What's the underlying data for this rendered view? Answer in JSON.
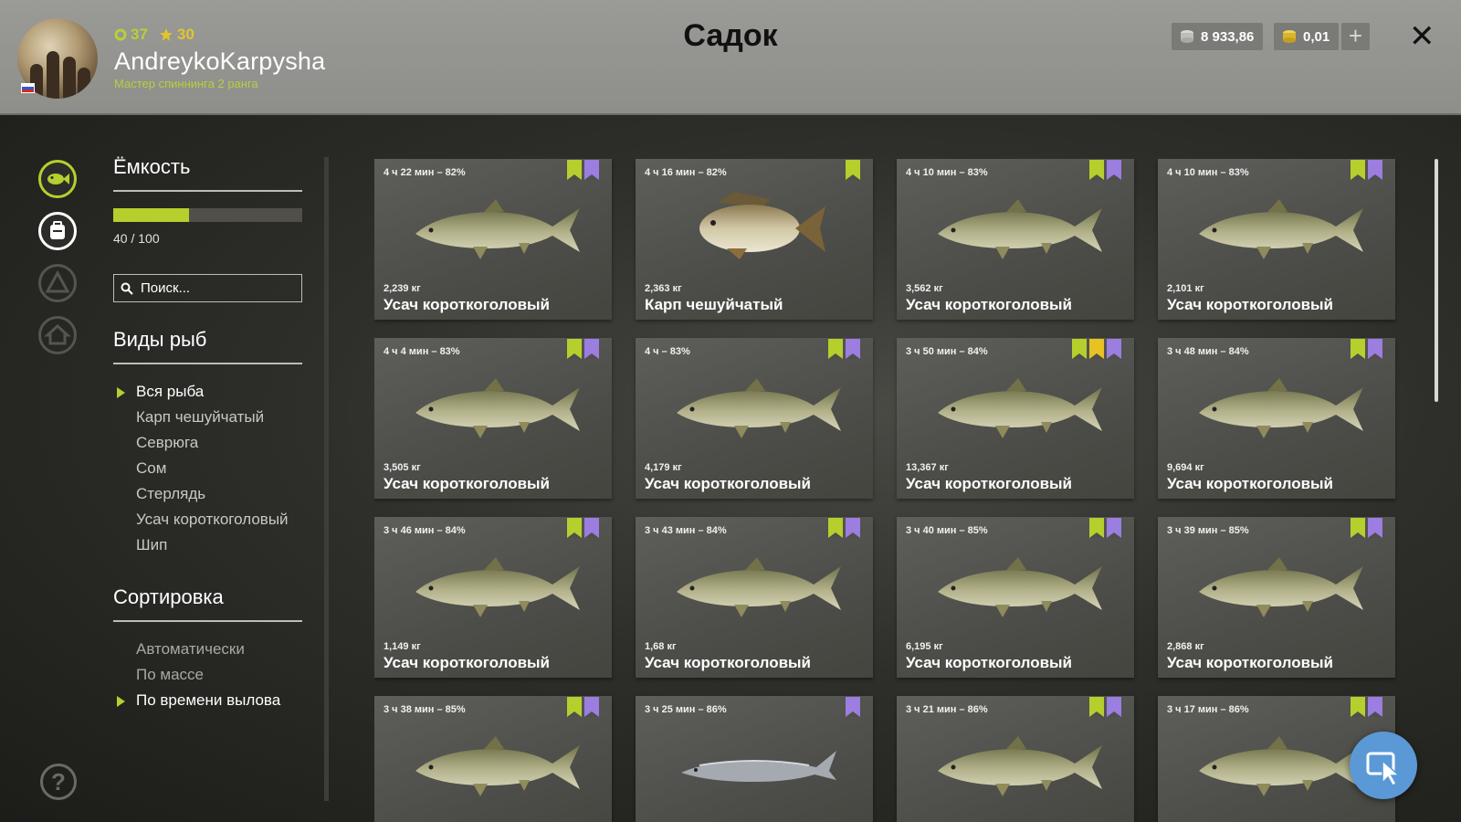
{
  "header": {
    "title": "Садок",
    "player": {
      "level": "37",
      "stars": "30",
      "username": "AndreykoKarpysha",
      "rank": "Мастер спиннинга 2 ранга"
    },
    "currency": {
      "silver": "8 933,86",
      "gold": "0,01",
      "add_label": "+"
    },
    "close_label": "✕"
  },
  "sidebar": {
    "capacity": {
      "title": "Ёмкость",
      "used": 40,
      "max": 100,
      "fraction": 0.4,
      "text": "40 / 100"
    },
    "search_placeholder": "Поиск...",
    "species": {
      "title": "Виды рыб",
      "items": [
        {
          "label": "Вся рыба",
          "active": true
        },
        {
          "label": "Карп чешуйчатый",
          "active": false
        },
        {
          "label": "Севрюга",
          "active": false
        },
        {
          "label": "Сом",
          "active": false
        },
        {
          "label": "Стерлядь",
          "active": false
        },
        {
          "label": "Усач короткоголовый",
          "active": false
        },
        {
          "label": "Шип",
          "active": false
        }
      ]
    },
    "sort": {
      "title": "Сортировка",
      "items": [
        {
          "label": "Автоматически",
          "active": false
        },
        {
          "label": "По массе",
          "active": false
        },
        {
          "label": "По времени вылова",
          "active": true
        }
      ]
    },
    "help_label": "?"
  },
  "fish": [
    {
      "time": "4 ч 22 мин – 82%",
      "weight": "2,239 кг",
      "name": "Усач короткоголовый",
      "kind": "barbel",
      "badges": [
        "green",
        "purple"
      ]
    },
    {
      "time": "4 ч 16 мин – 82%",
      "weight": "2,363 кг",
      "name": "Карп чешуйчатый",
      "kind": "carp",
      "badges": [
        "green"
      ]
    },
    {
      "time": "4 ч 10 мин – 83%",
      "weight": "3,562 кг",
      "name": "Усач короткоголовый",
      "kind": "barbel",
      "badges": [
        "green",
        "purple"
      ]
    },
    {
      "time": "4 ч 10 мин – 83%",
      "weight": "2,101 кг",
      "name": "Усач короткоголовый",
      "kind": "barbel",
      "badges": [
        "green",
        "purple"
      ]
    },
    {
      "time": "4 ч 4 мин – 83%",
      "weight": "3,505 кг",
      "name": "Усач короткоголовый",
      "kind": "barbel",
      "badges": [
        "green",
        "purple"
      ]
    },
    {
      "time": "4 ч – 83%",
      "weight": "4,179 кг",
      "name": "Усач короткоголовый",
      "kind": "barbel",
      "badges": [
        "green",
        "purple"
      ]
    },
    {
      "time": "3 ч 50 мин – 84%",
      "weight": "13,367 кг",
      "name": "Усач короткоголовый",
      "kind": "barbel",
      "badges": [
        "green",
        "gold",
        "purple"
      ]
    },
    {
      "time": "3 ч 48 мин – 84%",
      "weight": "9,694 кг",
      "name": "Усач короткоголовый",
      "kind": "barbel",
      "badges": [
        "green",
        "purple"
      ]
    },
    {
      "time": "3 ч 46 мин – 84%",
      "weight": "1,149 кг",
      "name": "Усач короткоголовый",
      "kind": "barbel",
      "badges": [
        "green",
        "purple"
      ]
    },
    {
      "time": "3 ч 43 мин – 84%",
      "weight": "1,68 кг",
      "name": "Усач короткоголовый",
      "kind": "barbel",
      "badges": [
        "green",
        "purple"
      ]
    },
    {
      "time": "3 ч 40 мин – 85%",
      "weight": "6,195 кг",
      "name": "Усач короткоголовый",
      "kind": "barbel",
      "badges": [
        "green",
        "purple"
      ]
    },
    {
      "time": "3 ч 39 мин – 85%",
      "weight": "2,868 кг",
      "name": "Усач короткоголовый",
      "kind": "barbel",
      "badges": [
        "green",
        "purple"
      ]
    },
    {
      "time": "3 ч 38 мин – 85%",
      "weight": "",
      "name": "",
      "kind": "barbel",
      "badges": [
        "green",
        "purple"
      ]
    },
    {
      "time": "3 ч 25 мин – 86%",
      "weight": "",
      "name": "",
      "kind": "sturgeon",
      "badges": [
        "purple"
      ]
    },
    {
      "time": "3 ч 21 мин – 86%",
      "weight": "",
      "name": "",
      "kind": "barbel",
      "badges": [
        "green",
        "purple"
      ]
    },
    {
      "time": "3 ч 17 мин – 86%",
      "weight": "",
      "name": "",
      "kind": "barbel",
      "badges": [
        "green",
        "purple"
      ]
    }
  ],
  "colors": {
    "accent": "#b6cf2d",
    "purple_badge": "#9c7de0",
    "gold_badge": "#e6c223",
    "float_button": "#5b99d6"
  }
}
